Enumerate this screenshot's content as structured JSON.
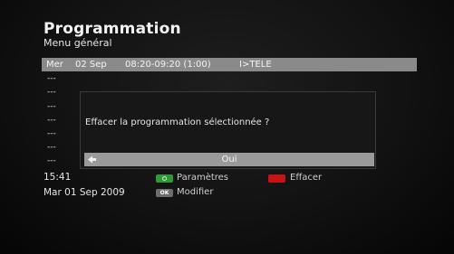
{
  "header": {
    "title": "Programmation",
    "subtitle": "Menu général"
  },
  "list": {
    "header": {
      "day": "Mer",
      "date": "02 Sep",
      "time_range": "08:20-09:20 (1:00)",
      "channel": "I>TELE"
    },
    "rows": [
      "---",
      "---",
      "---",
      "---",
      "---",
      "---",
      "---"
    ]
  },
  "dialog": {
    "message": "Effacer la programmation sélectionnée ?",
    "button_label": "Oui",
    "arrow_icon": "arrow-left-icon"
  },
  "status": {
    "time": "15:41",
    "date": "Mar 01 Sep 2009"
  },
  "legend": {
    "parameters": {
      "key_color": "#2f9a33",
      "label": "Paramètres",
      "icon": "green-key-icon"
    },
    "erase": {
      "key_color": "#c41414",
      "label": "Effacer",
      "icon": "red-key-icon"
    },
    "modify": {
      "key_text": "OK",
      "label": "Modifier",
      "icon": "ok-key-icon"
    }
  },
  "colors": {
    "list_header_bg": "#8a8a8a",
    "dialog_button_bg": "#9a9a9a"
  }
}
